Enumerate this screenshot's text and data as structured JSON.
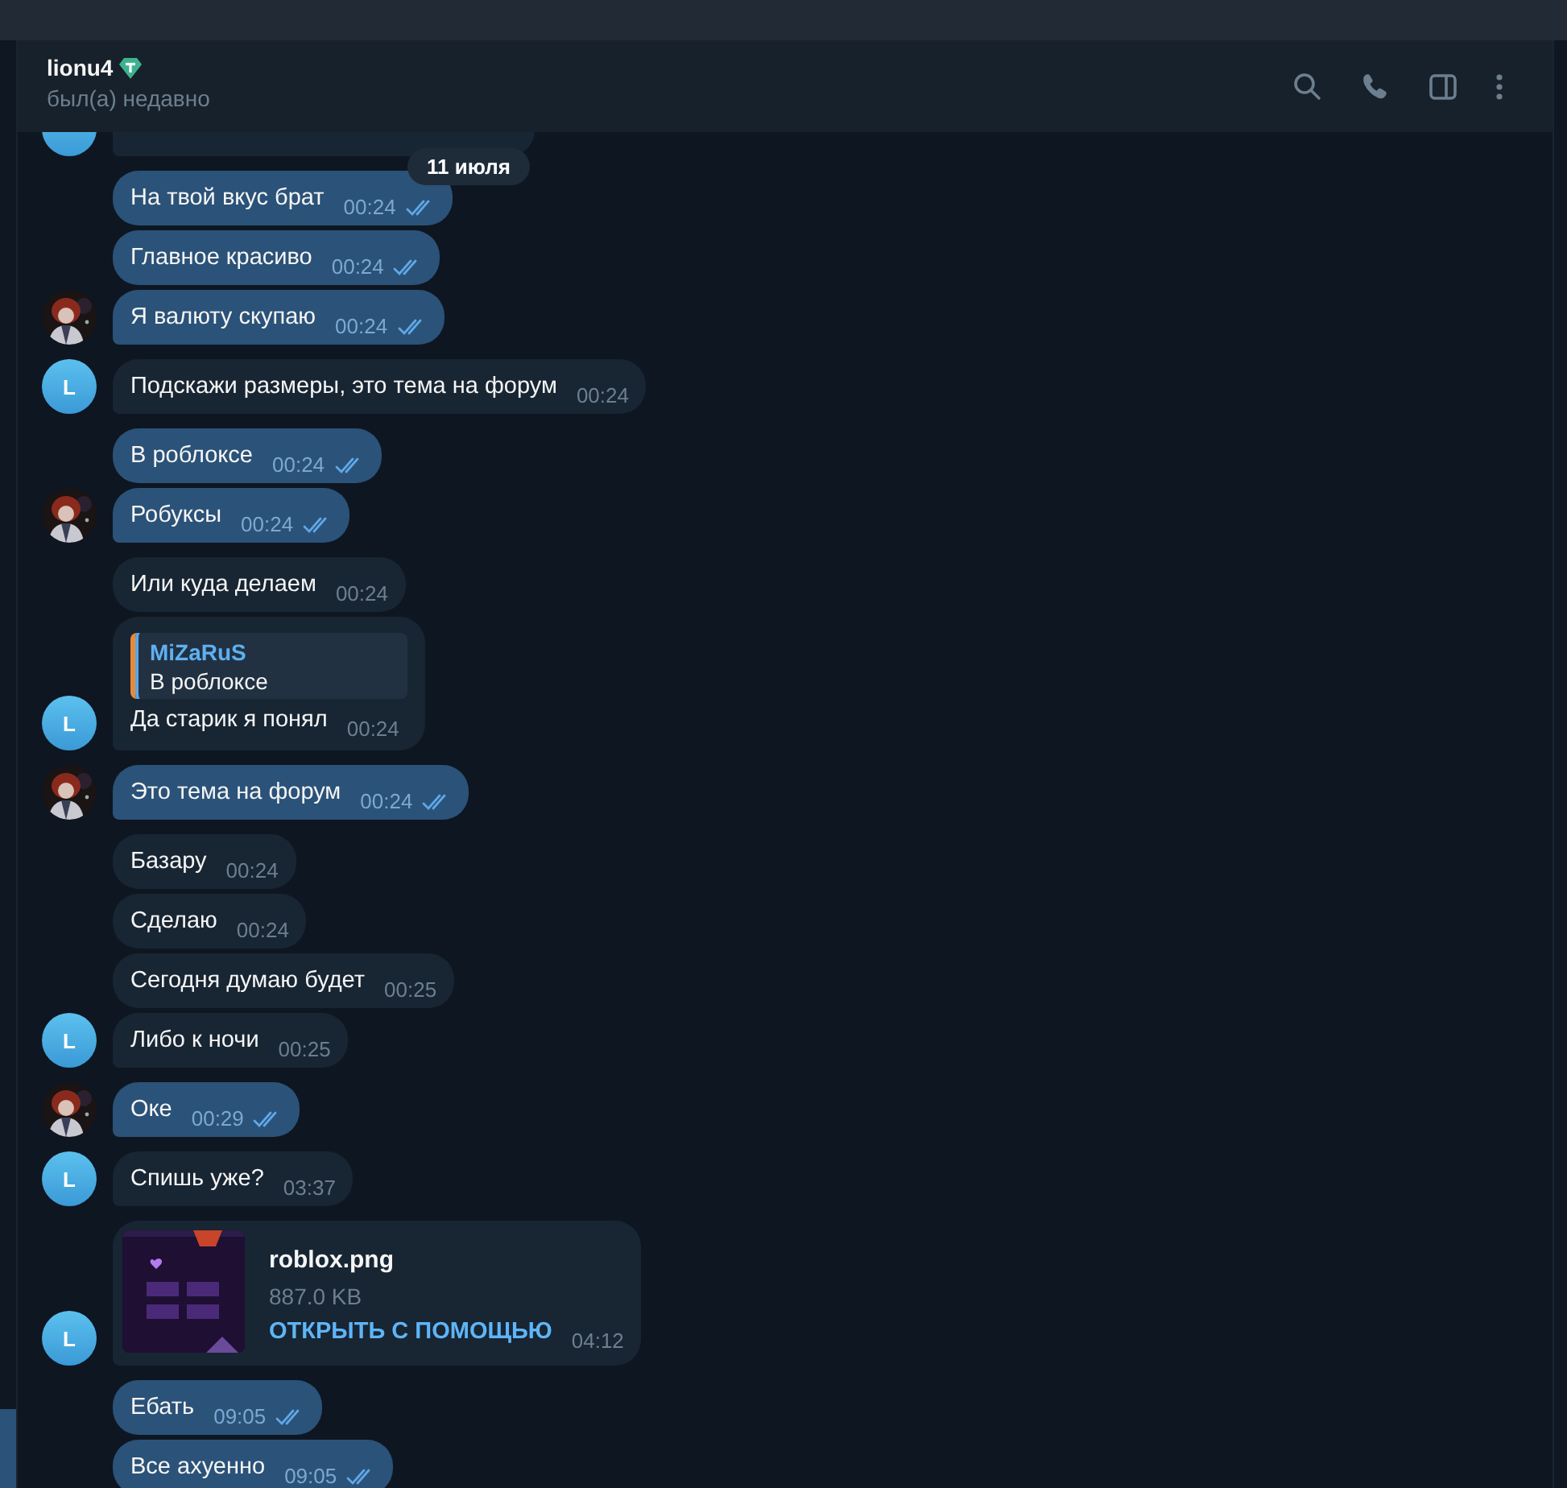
{
  "header": {
    "name": "lionu4",
    "status": "был(а) недавно"
  },
  "date_pill": "11 июля",
  "messages": [
    {
      "kind": "cut",
      "outgoing": false,
      "avatar": {
        "kind": "letter"
      }
    },
    {
      "kind": "text",
      "outgoing": true,
      "text": "На твой вкус брат",
      "time": "00:24",
      "read": true
    },
    {
      "kind": "text",
      "outgoing": true,
      "text": "Главное красиво",
      "time": "00:24",
      "read": true
    },
    {
      "kind": "text",
      "outgoing": true,
      "text": "Я валюту скупаю",
      "time": "00:24",
      "read": true
    },
    {
      "kind": "text",
      "outgoing": false,
      "text": "Подскажи размеры, это тема на форум",
      "time": "00:24",
      "avatar": {
        "kind": "letter",
        "letter": "L"
      }
    },
    {
      "kind": "text",
      "outgoing": true,
      "text": "В роблоксе",
      "time": "00:24",
      "read": true
    },
    {
      "kind": "text",
      "outgoing": true,
      "text": "Робуксы",
      "time": "00:24",
      "read": true
    },
    {
      "kind": "text",
      "outgoing": false,
      "text": "Или куда делаем",
      "time": "00:24"
    },
    {
      "kind": "reply",
      "outgoing": false,
      "quote_name": "MiZaRuS",
      "quote_text": "В роблоксе",
      "text": "Да старик я понял",
      "time": "00:24",
      "avatar": {
        "kind": "letter",
        "letter": "L"
      }
    },
    {
      "kind": "text",
      "outgoing": true,
      "text": "Это тема на форум",
      "time": "00:24",
      "read": true
    },
    {
      "kind": "text",
      "outgoing": false,
      "text": "Базару",
      "time": "00:24"
    },
    {
      "kind": "text",
      "outgoing": false,
      "text": "Сделаю",
      "time": "00:24"
    },
    {
      "kind": "text",
      "outgoing": false,
      "text": "Сегодня думаю будет",
      "time": "00:25"
    },
    {
      "kind": "text",
      "outgoing": false,
      "text": "Либо к ночи",
      "time": "00:25",
      "avatar": {
        "kind": "letter",
        "letter": "L"
      }
    },
    {
      "kind": "text",
      "outgoing": true,
      "text": "Оке",
      "time": "00:29",
      "read": true
    },
    {
      "kind": "text",
      "outgoing": false,
      "text": "Спишь уже?",
      "time": "03:37",
      "avatar": {
        "kind": "letter",
        "letter": "L"
      }
    },
    {
      "kind": "file",
      "outgoing": false,
      "file_name": "roblox.png",
      "size": "887.0 KB",
      "action": "ОТКРЫТЬ С ПОМОЩЬЮ",
      "time": "04:12",
      "avatar": {
        "kind": "letter",
        "letter": "L"
      }
    },
    {
      "kind": "text",
      "outgoing": true,
      "text": "Ебать",
      "time": "09:05",
      "read": true
    },
    {
      "kind": "text",
      "outgoing": true,
      "text": "Все ахуенно",
      "time": "09:05",
      "read": true
    }
  ]
}
